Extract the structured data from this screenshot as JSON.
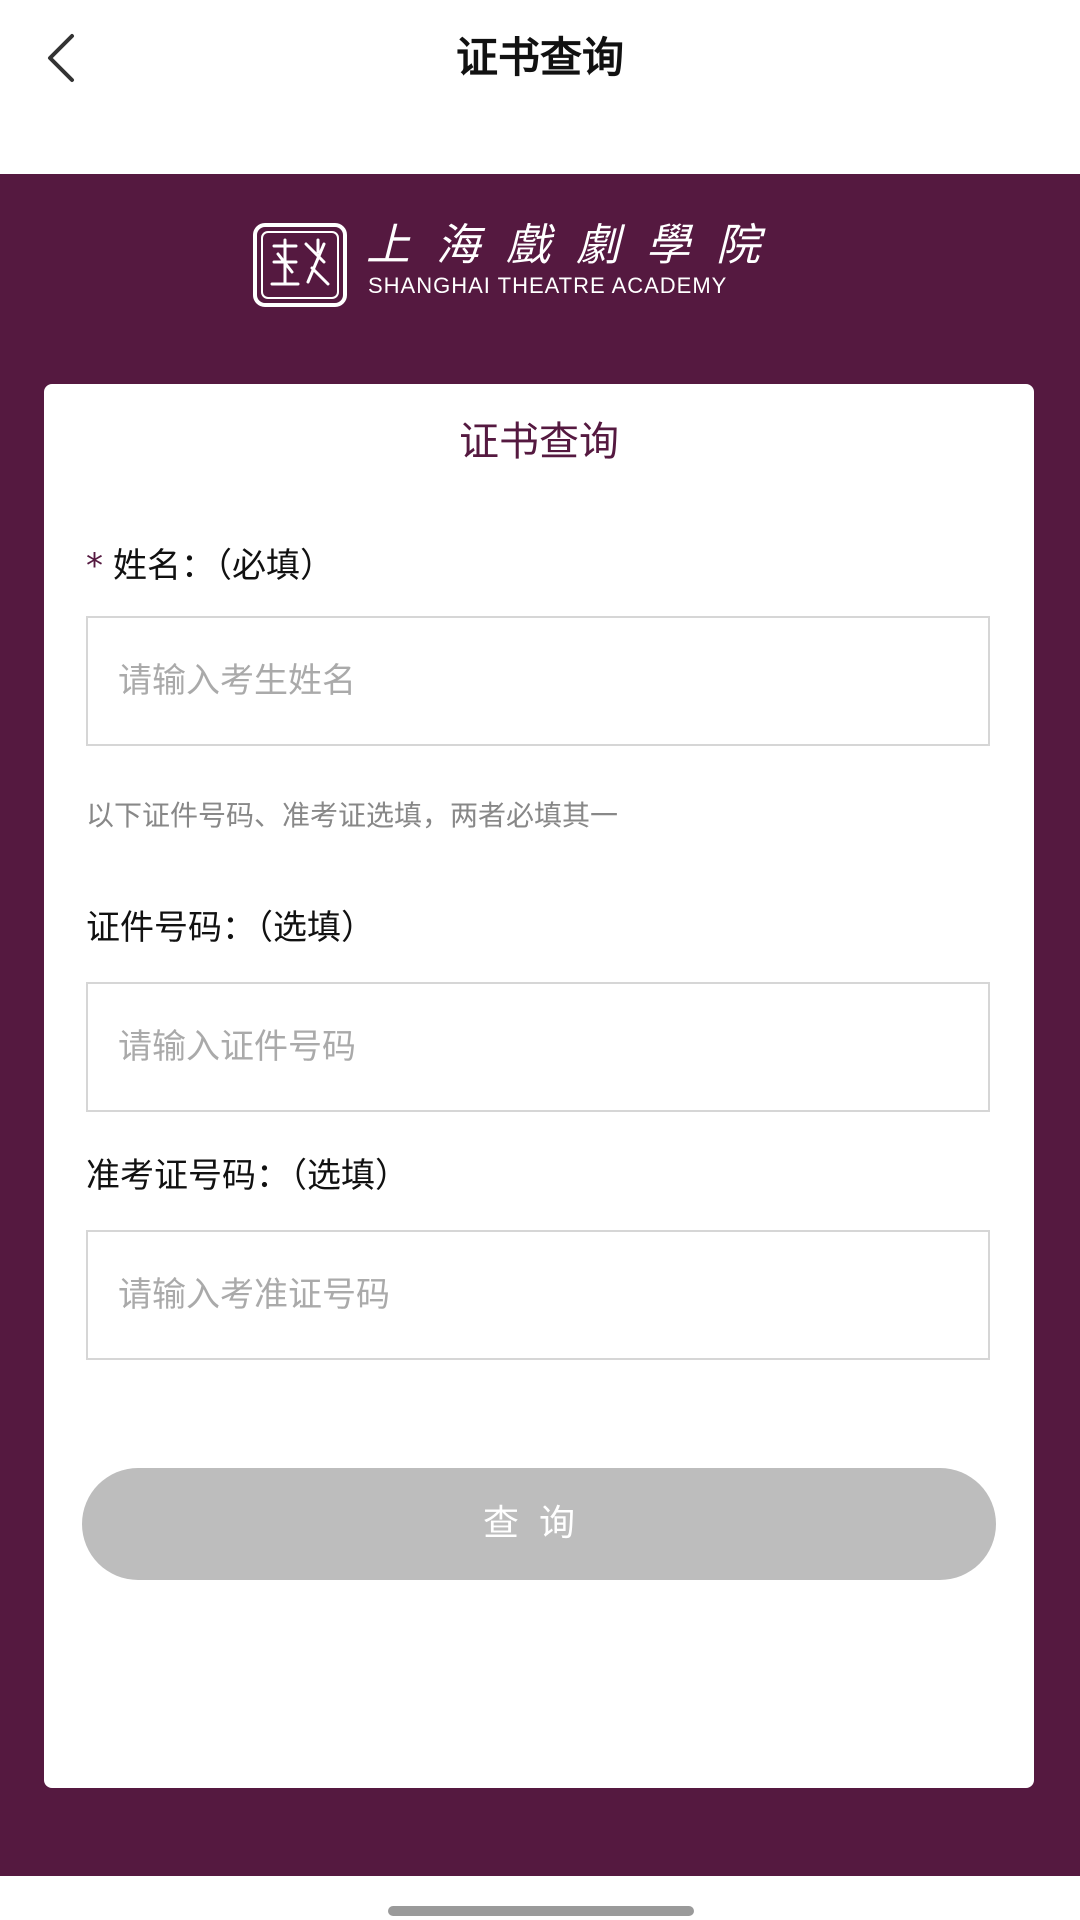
{
  "nav": {
    "title": "证书查询",
    "back_icon": "chevron-left-icon"
  },
  "logo": {
    "name_cn": "上海戲劇學院",
    "name_en": "SHANGHAI THEATRE ACADEMY",
    "seal_icon": "academy-seal-icon"
  },
  "colors": {
    "brand": "#551940",
    "button_disabled": "#bdbdbd",
    "placeholder": "#aaaaaa"
  },
  "form": {
    "title": "证书查询",
    "name_field": {
      "required_mark": "*",
      "label": "姓名：（必填）",
      "placeholder": "请输入考生姓名",
      "value": ""
    },
    "hint": "以下证件号码、准考证选填，两者必填其一",
    "id_field": {
      "label": "证件号码：（选填）",
      "placeholder": "请输入证件号码",
      "value": ""
    },
    "ticket_field": {
      "label": "准考证号码：（选填）",
      "placeholder": "请输入考准证号码",
      "value": ""
    },
    "submit_label": "查询"
  }
}
